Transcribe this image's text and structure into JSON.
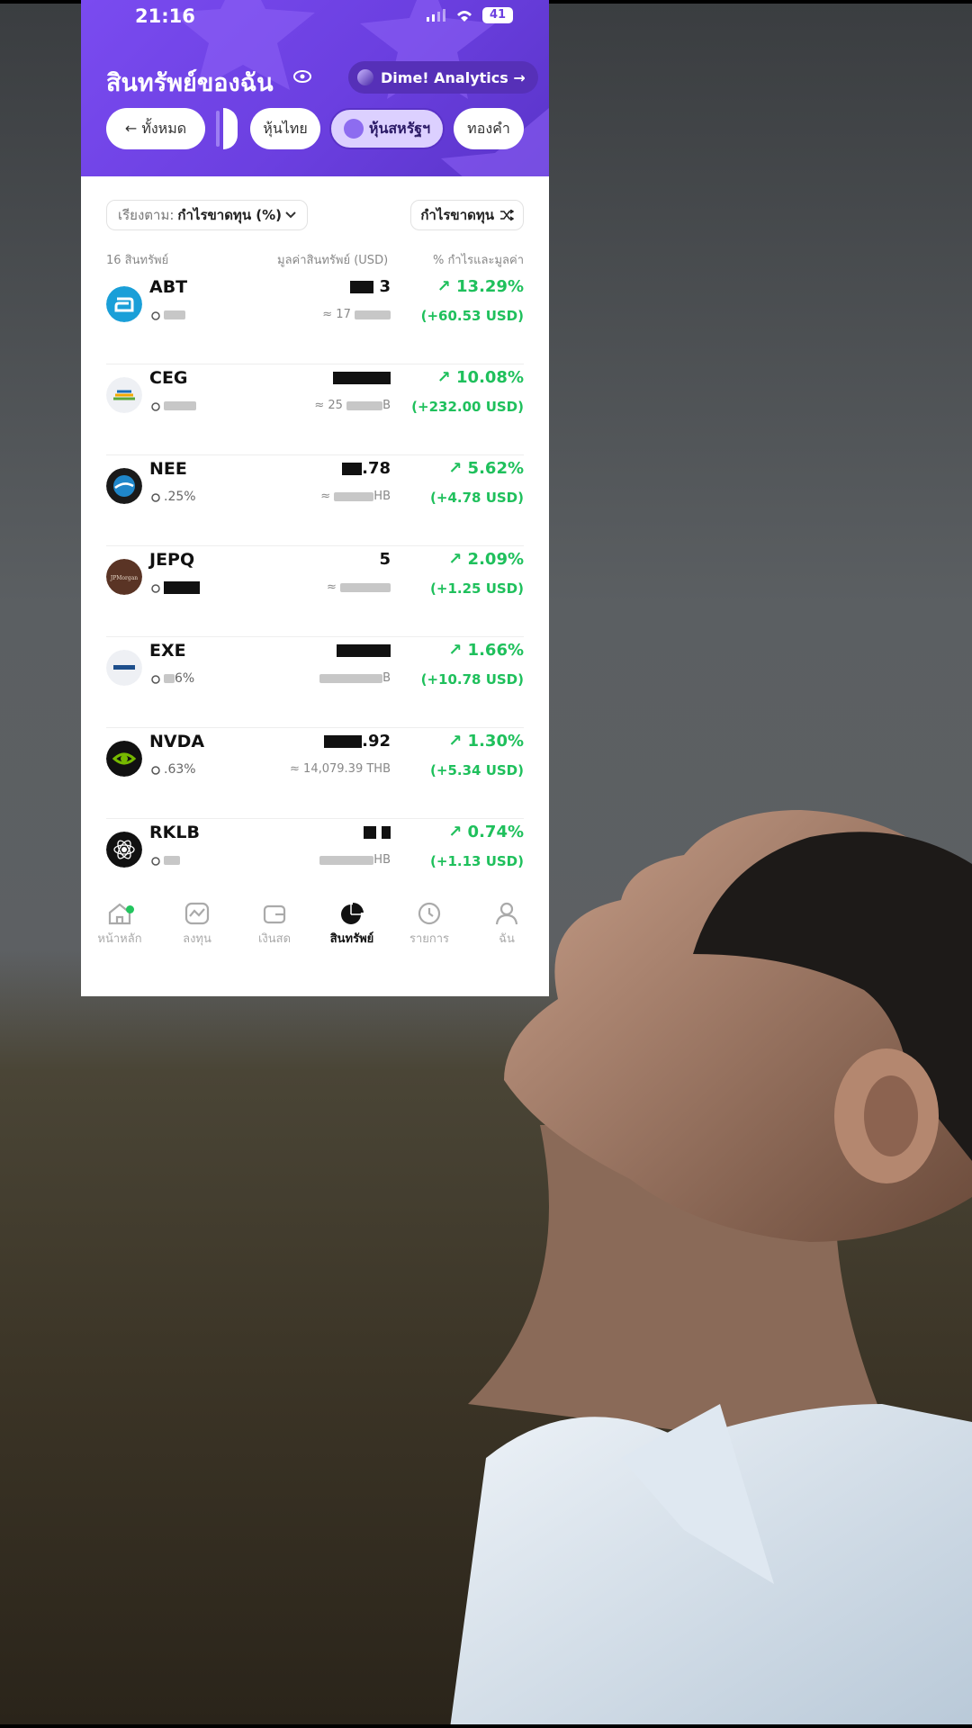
{
  "status_bar": {
    "time": "21:16",
    "battery": "41"
  },
  "header": {
    "title": "สินทรัพย์ของฉัน",
    "analytics_label": "Dime! Analytics →"
  },
  "filters": {
    "all": "← ทั้งหมด",
    "thai": "หุ้นไทย",
    "us": "หุ้นสหรัฐฯ",
    "gold": "ทองคำ"
  },
  "controls": {
    "sort_prefix": "เรียงตาม:",
    "sort_value": "กำไรขาดทุน (%)",
    "filter_label": "กำไรขาดทุน"
  },
  "columns": {
    "count": "16 สินทรัพย์",
    "value": "มูลค่าสินทรัพย์ (USD)",
    "profit": "% กำไรและมูลค่า"
  },
  "assets": [
    {
      "ticker": "ABT",
      "value_tail": "3",
      "small": "",
      "sub": "≈ 17",
      "sub_tail": "",
      "pct": "↗ 13.29%",
      "usd": "(+60.53 USD)"
    },
    {
      "ticker": "CEG",
      "value_tail": "",
      "small": "",
      "sub": "≈ 25",
      "sub_tail": "B",
      "pct": "↗ 10.08%",
      "usd": "(+232.00 USD)"
    },
    {
      "ticker": "NEE",
      "value_tail": ".78",
      "small": ".25%",
      "sub": "≈",
      "sub_tail": "HB",
      "pct": "↗ 5.62%",
      "usd": "(+4.78 USD)"
    },
    {
      "ticker": "JEPQ",
      "value_tail": "5",
      "small": "",
      "sub": "≈",
      "sub_tail": "",
      "pct": "↗ 2.09%",
      "usd": "(+1.25 USD)"
    },
    {
      "ticker": "EXE",
      "value_tail": "",
      "small": "6%",
      "sub": "",
      "sub_tail": "B",
      "pct": "↗ 1.66%",
      "usd": "(+10.78 USD)"
    },
    {
      "ticker": "NVDA",
      "value_tail": ".92",
      "small": ".63%",
      "sub": "≈ 14,079.39 THB",
      "sub_tail": "",
      "pct": "↗ 1.30%",
      "usd": "(+5.34 USD)"
    },
    {
      "ticker": "RKLB",
      "value_tail": "",
      "small": "",
      "sub": "",
      "sub_tail": "HB",
      "pct": "↗ 0.74%",
      "usd": "(+1.13 USD)"
    }
  ],
  "tabs": [
    {
      "label": "หน้าหลัก",
      "icon": "home-icon"
    },
    {
      "label": "ลงทุน",
      "icon": "invest-icon"
    },
    {
      "label": "เงินสด",
      "icon": "wallet-icon"
    },
    {
      "label": "สินทรัพย์",
      "icon": "pie-icon"
    },
    {
      "label": "รายการ",
      "icon": "history-icon"
    },
    {
      "label": "ฉัน",
      "icon": "user-icon"
    }
  ],
  "colors": {
    "brand": "#6b3fe0",
    "positive": "#1fc05c"
  }
}
